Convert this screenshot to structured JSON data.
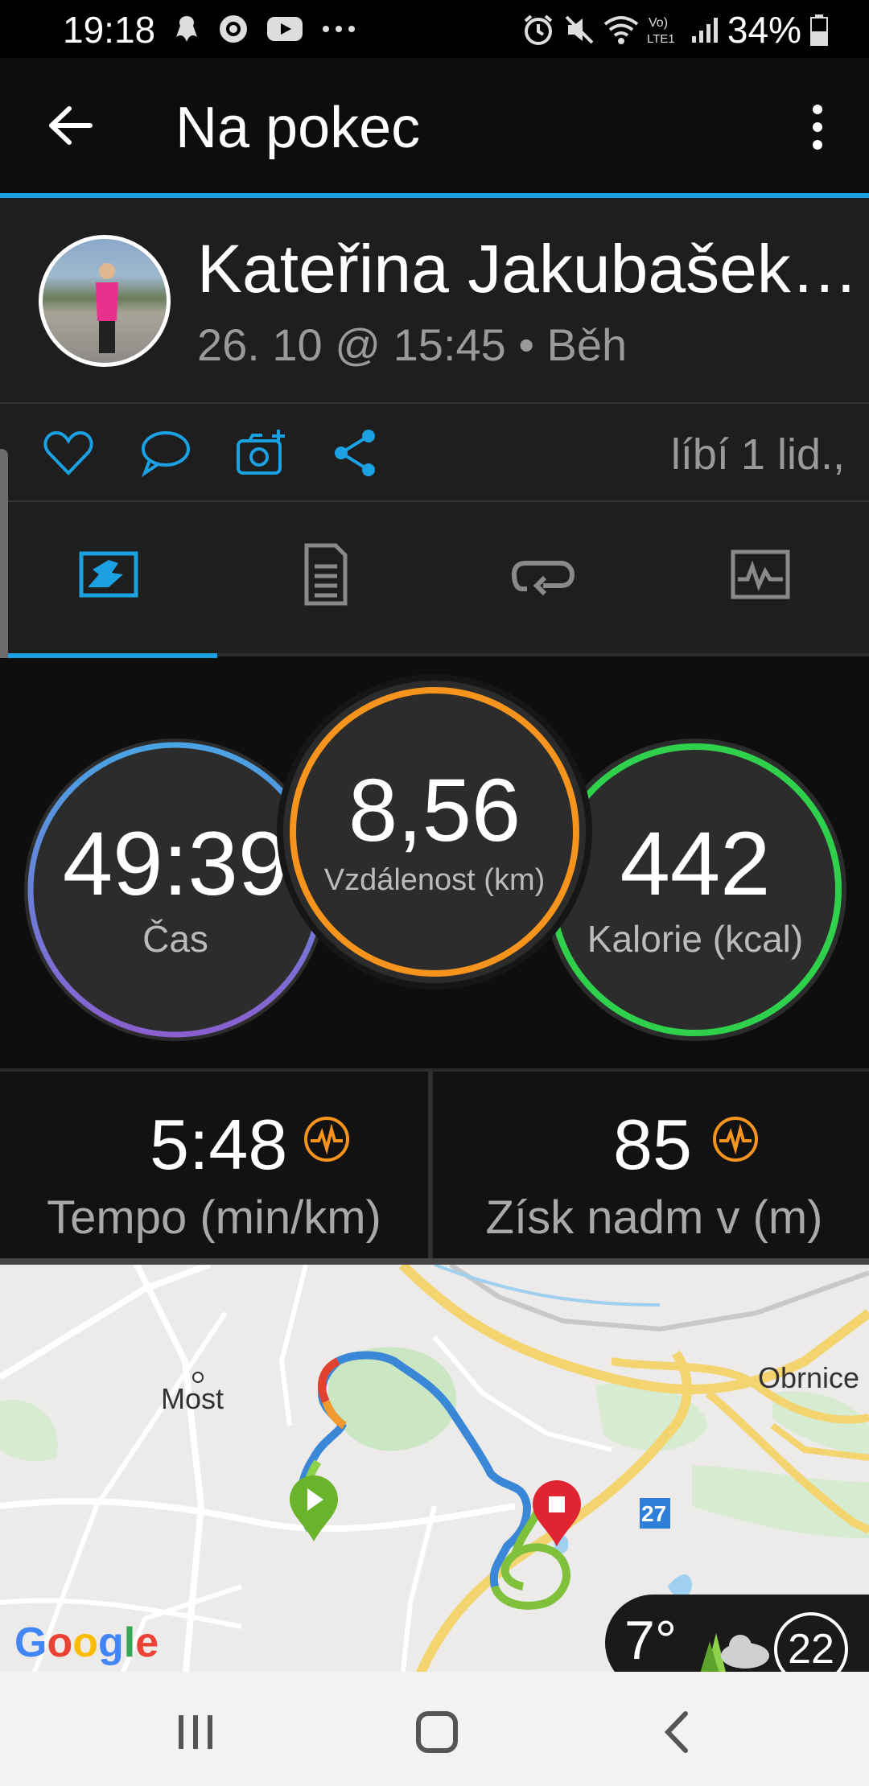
{
  "status_bar": {
    "time": "19:18",
    "battery": "34%",
    "icons_left": [
      "bubble-icon",
      "target-icon",
      "youtube-icon",
      "more-dots-icon"
    ],
    "icons_right": [
      "alarm-icon",
      "mute-icon",
      "wifi-icon",
      "volte-icon",
      "signal-icon",
      "battery-icon"
    ]
  },
  "app_bar": {
    "title": "Na pokec"
  },
  "profile": {
    "name": "Kateřina Jakubašek…",
    "meta": "26. 10 @ 15:45 • Běh"
  },
  "actions": {
    "likes": "líbí 1 lid.,",
    "accent": "#1ba1e2"
  },
  "tabs": [
    "overview-tab-icon",
    "details-tab-icon",
    "laps-tab-icon",
    "chart-tab-icon"
  ],
  "stats": {
    "time": {
      "value": "49:39",
      "label": "Čas",
      "color": "#5b8fd6"
    },
    "distance": {
      "value": "8,56",
      "label": "Vzdálenost (km)",
      "color": "#f7941d"
    },
    "calories": {
      "value": "442",
      "label": "Kalorie (kcal)",
      "color": "#33d35a"
    },
    "pace": {
      "value": "5:48",
      "label": "Tempo (min/km)"
    },
    "ascent": {
      "value": "85",
      "label": "Získ nadm v (m)"
    }
  },
  "map": {
    "labels": {
      "most": "Most",
      "obrnice": "Obrnice",
      "road": "27"
    },
    "google": "Google",
    "weather": {
      "temp": "7°",
      "wind": "22"
    }
  }
}
